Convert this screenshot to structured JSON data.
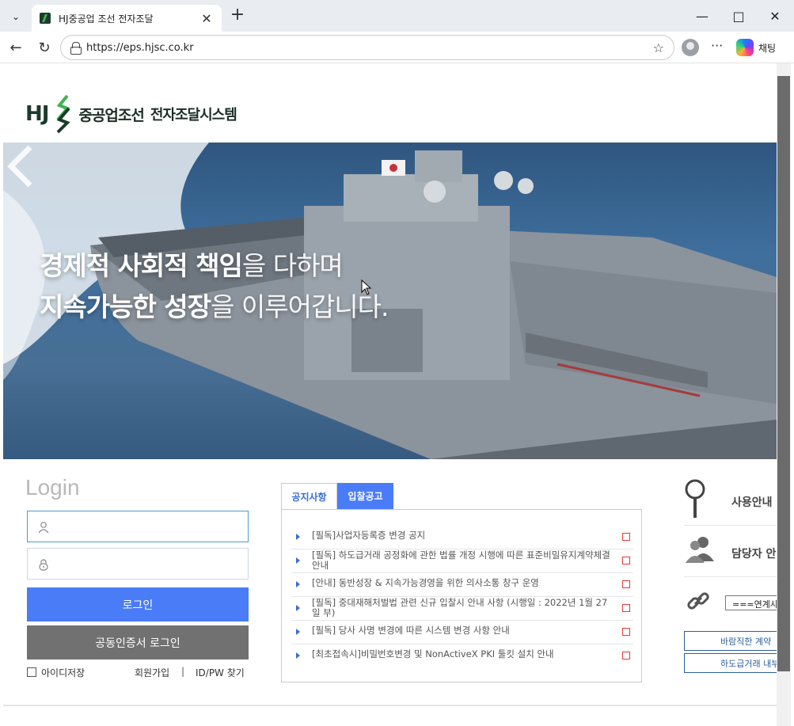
{
  "browser": {
    "tab_title": "HJ중공업 조선 전자조달",
    "url": "https://eps.hjsc.co.kr",
    "copilot_label": "채팅"
  },
  "header": {
    "logo_hj": "HJ",
    "logo_name": "중공업조선",
    "logo_sub": "전자조달시스템"
  },
  "hero": {
    "line1_bold": "경제적 사회적 책임",
    "line1_rest": "을 다하며",
    "line2_bold": "지속가능한 성장",
    "line2_rest": "을 이루어갑니다."
  },
  "login": {
    "title": "Login",
    "login_button": "로그인",
    "cert_button": "공동인증서 로그인",
    "save_id": "아이디저장",
    "join": "회원가입",
    "separator": "|",
    "find": "ID/PW 찾기"
  },
  "notice": {
    "tabs": [
      "공지사항",
      "입찰공고"
    ],
    "items": [
      "[필독]사업자등록증 변경 공지",
      "[필독] 하도급거래 공정화에 관한 법률 개정 시행에 따른 표준비밀유지계약체결 안내",
      "[안내] 동반성장 & 지속가능경영을 위한 의사소통 창구 운영",
      "[필독] 중대재해처벌법 관련 신규 입찰시 안내 사항 (시행일 : 2022년 1월 27일 부)",
      "[필독] 당사 사명 변경에 따른 시스템 변경 사항 안내",
      "[최초접속시]비밀번호변경 및 NonActiveX PKI 툴킷 설치 안내"
    ]
  },
  "side": {
    "guide": "사용안내",
    "contact": "담당자 안",
    "link_select": "===연계사",
    "btn1": "바람직한 계약",
    "btn2": "하도급거래 내부"
  },
  "colors": {
    "brand_dark": "#1c3b2c",
    "brand_green": "#3fb34f",
    "accent_blue": "#4a7cf7",
    "cert_gray": "#717171"
  }
}
